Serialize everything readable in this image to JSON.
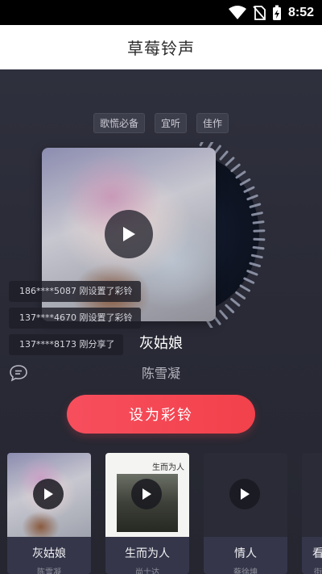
{
  "status_bar": {
    "time": "8:52",
    "icons": [
      "wifi-icon",
      "no-sim-icon",
      "battery-charging-icon"
    ]
  },
  "header": {
    "title": "草莓铃声"
  },
  "tags": [
    "歌慌必备",
    "宜听",
    "佳作"
  ],
  "player": {
    "song_title": "灰姑娘",
    "artist": "陈雪凝",
    "set_ringtone_label": "设为彩铃"
  },
  "notifications": [
    "186****5087 刚设置了彩铃",
    "137****4670 刚设置了彩铃",
    "137****8173 刚分享了"
  ],
  "cards": [
    {
      "title": "灰姑娘",
      "artist": "陈雪凝"
    },
    {
      "title": "生而为人",
      "artist": "尚士达",
      "cover_text": "生而为人"
    },
    {
      "title": "情人",
      "artist": "蔡徐坤"
    },
    {
      "title": "看",
      "artist": "街"
    }
  ],
  "colors": {
    "accent": "#f2414b",
    "background": "#2b2c38"
  }
}
